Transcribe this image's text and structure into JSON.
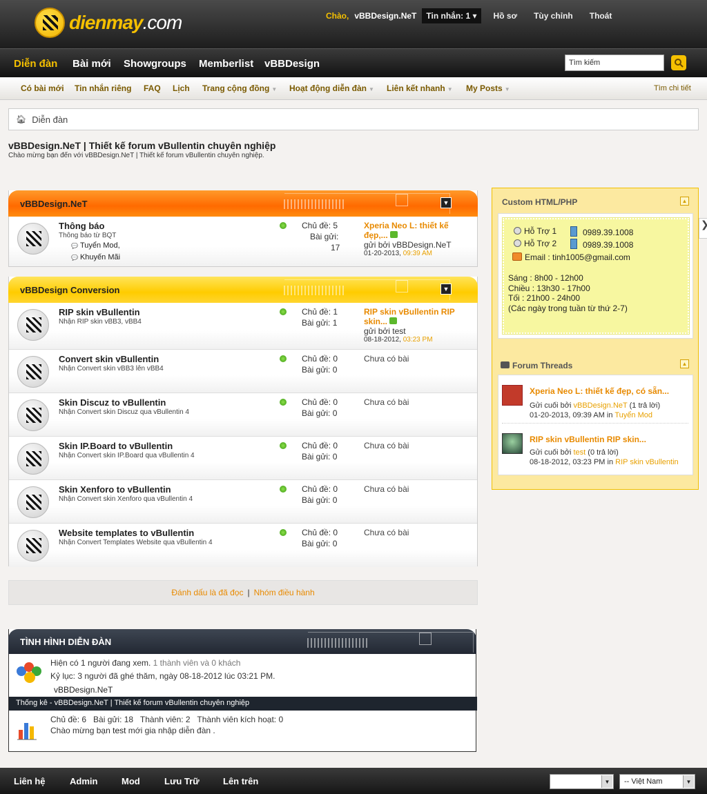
{
  "header": {
    "logo_main": "dienmay",
    "logo_suffix": ".com",
    "greeting": "Chào,",
    "username": "vBBDesign.NeT",
    "messages": "Tin nhắn: 1",
    "links": [
      "Hồ sơ",
      "Tùy chỉnh",
      "Thoát"
    ]
  },
  "nav": {
    "items": [
      "Diễn đàn",
      "Bài mới",
      "Showgroups",
      "Memberlist",
      "vBBDesign"
    ],
    "search_placeholder": "Tìm kiếm"
  },
  "subnav": {
    "items": [
      "Có bài mới",
      "Tin nhắn riêng",
      "FAQ",
      "Lịch",
      "Trang cộng đồng",
      "Hoạt động diễn đàn",
      "Liên kết nhanh",
      "My Posts"
    ],
    "advanced": "Tìm chi tiết"
  },
  "breadcrumb": "Diễn đàn",
  "page": {
    "title": "vBBDesign.NeT | Thiết kế forum vBullentin chuyên nghiệp",
    "description": "Chào mừng bạn đến với vBBDesign.NeT | Thiết kế forum vBullentin chuyên nghiệp."
  },
  "categories": [
    {
      "name": "vBBDesign.NeT",
      "forums": [
        {
          "title": "Thông báo",
          "desc": "Thông báo từ BQT",
          "subs": [
            "Tuyển Mod,",
            "Khuyến Mãi"
          ],
          "threads": "Chủ đề: 5",
          "posts_label": "Bài gửi:",
          "posts_value": "17",
          "last_title": "Xperia Neo L: thiết kế đẹp,...",
          "last_by_prefix": "gửi bởi",
          "last_by": "vBBDesign.NeT",
          "last_date": "01-20-2013,",
          "last_time": "09:39 AM"
        }
      ]
    },
    {
      "name": "vBBDesign Conversion",
      "forums": [
        {
          "title": "RIP skin vBullentin",
          "desc": "Nhận RIP skin vBB3, vBB4",
          "threads": "Chủ đề: 1",
          "posts": "Bài gửi: 1",
          "last_title": "RIP skin vBullentin RIP skin...",
          "last_by_prefix": "gửi bởi",
          "last_by": "test",
          "last_date": "08-18-2012,",
          "last_time": "03:23 PM"
        },
        {
          "title": "Convert skin vBullentin",
          "desc": "Nhận Convert skin vBB3 lên vBB4",
          "threads": "Chủ đề: 0",
          "posts": "Bài gửi: 0",
          "last_none": "Chưa có bài"
        },
        {
          "title": "Skin Discuz to vBullentin",
          "desc": "Nhận Convert skin Discuz qua vBullentin 4",
          "threads": "Chủ đề: 0",
          "posts": "Bài gửi: 0",
          "last_none": "Chưa có bài"
        },
        {
          "title": "Skin IP.Board to vBullentin",
          "desc": "Nhận Convert skin IP.Board qua vBullentin 4",
          "threads": "Chủ đề: 0",
          "posts": "Bài gửi: 0",
          "last_none": "Chưa có bài"
        },
        {
          "title": "Skin Xenforo to vBullentin",
          "desc": "Nhận Convert skin Xenforo qua vBullentin 4",
          "threads": "Chủ đề: 0",
          "posts": "Bài gửi: 0",
          "last_none": "Chưa có bài"
        },
        {
          "title": "Website templates to vBullentin",
          "desc": "Nhận Convert Templates Website qua vBullentin 4",
          "threads": "Chủ đề: 0",
          "posts": "Bài gửi: 0",
          "last_none": "Chưa có bài"
        }
      ]
    }
  ],
  "markbar": {
    "mark_read": "Đánh dấu là đã đọc",
    "separator": "|",
    "staff": "Nhóm điều hành"
  },
  "stats": {
    "title": "TÌNH HÌNH DIỄN ĐÀN",
    "online_prefix": "Hiện có",
    "online_count": "1 người đang xem.",
    "online_detail": "1 thành viên và 0 khách",
    "record": "Kỷ lục: 3 người đã ghé thăm, ngày 08-18-2012 lúc 03:21 PM.",
    "online_user": "vBBDesign.NeT",
    "bar": "Thống kê - vBBDesign.NeT | Thiết kế forum vBullentin chuyên nghiệp",
    "counts": "Chủ đề: 6   Bài gửi: 18   Thành viên: 2   Thành viên kích hoạt: 0",
    "welcome_prefix": "Chào mừng bạn",
    "welcome_user": "test",
    "welcome_suffix": "mới gia nhập diễn đàn ."
  },
  "sidebar": {
    "custom_title": "Custom HTML/PHP",
    "support": [
      {
        "label": "Hỗ Trợ 1",
        "phone": "0989.39.1008"
      },
      {
        "label": "Hỗ Trợ 2",
        "phone": "0989.39.1008"
      }
    ],
    "email": "Email : tinh1005@gmail.com",
    "hours": [
      "Sáng : 8h00 - 12h00",
      "Chiều : 13h30 - 17h00",
      "Tối : 21h00 - 24h00",
      "(Các ngày trong tuần từ thứ 2-7)"
    ],
    "threads_title": "Forum Threads",
    "threads": [
      {
        "title": "Xperia Neo L: thiết kế đẹp, có sẵn...",
        "by_prefix": "Gửi cuối bởi",
        "by": "vBBDesign.NeT",
        "replies": "(1 trả lời)",
        "date": "01-20-2013, 09:39 AM in",
        "forum": "Tuyển Mod"
      },
      {
        "title": "RIP skin vBullentin RIP skin...",
        "by_prefix": "Gửi cuối bởi",
        "by": "test",
        "replies": "(0 trả lời)",
        "date": "08-18-2012, 03:23 PM in",
        "forum": "RIP skin vBullentin"
      }
    ]
  },
  "footer": {
    "links": [
      "Liên hệ",
      "Admin",
      "Mod",
      "Lưu Trữ",
      "Lên trên"
    ],
    "style_select": "",
    "language_select": "-- Việt Nam"
  },
  "colors": {
    "accent": "#f5c000",
    "link_orange": "#e88a00",
    "header_dark": "#1d1d1d"
  }
}
